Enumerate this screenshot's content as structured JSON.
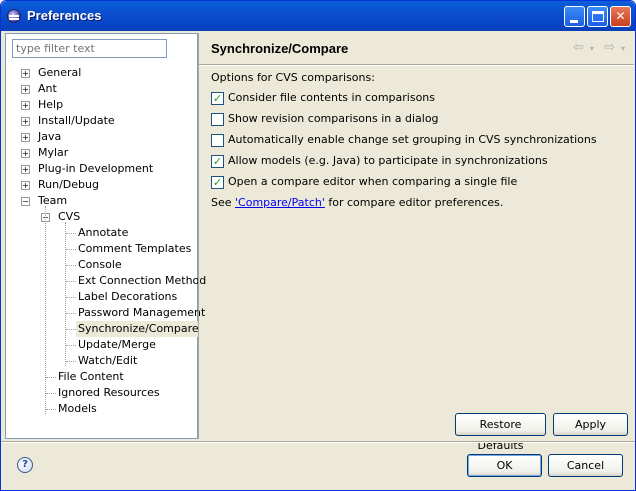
{
  "window": {
    "title": "Preferences"
  },
  "filter": {
    "placeholder": "type filter text"
  },
  "tree": {
    "top_items": [
      "General",
      "Ant",
      "Help",
      "Install/Update",
      "Java",
      "Mylar",
      "Plug-in Development",
      "Run/Debug",
      "Team"
    ],
    "team_child": "CVS",
    "cvs_children": [
      "Annotate",
      "Comment Templates",
      "Console",
      "Ext Connection Method",
      "Label Decorations",
      "Password Management",
      "Synchronize/Compare",
      "Update/Merge",
      "Watch/Edit"
    ],
    "team_leaves": [
      "File Content",
      "Ignored Resources",
      "Models"
    ],
    "selected": "Synchronize/Compare"
  },
  "page": {
    "title": "Synchronize/Compare",
    "options_label": "Options for CVS comparisons:",
    "options": [
      {
        "label": "Consider file contents in comparisons",
        "checked": true
      },
      {
        "label": "Show revision comparisons in a dialog",
        "checked": false
      },
      {
        "label": "Automatically enable change set grouping in CVS synchronizations",
        "checked": false
      },
      {
        "label": "Allow models (e.g. Java) to participate in synchronizations",
        "checked": true
      },
      {
        "label": "Open a compare editor when comparing a single file",
        "checked": true
      }
    ],
    "see_prefix": "See ",
    "see_link": "'Compare/Patch'",
    "see_suffix": " for compare editor preferences."
  },
  "buttons": {
    "restore_defaults": "Restore Defaults",
    "apply": "Apply",
    "ok": "OK",
    "cancel": "Cancel"
  },
  "nav": {
    "back": "⇦",
    "forward": "⇨"
  },
  "help": {
    "glyph": "?"
  },
  "colors": {
    "title_bar": "#0a5fd8",
    "selection": "#ece9d8",
    "link": "#0000ee",
    "check": "#21a121"
  }
}
